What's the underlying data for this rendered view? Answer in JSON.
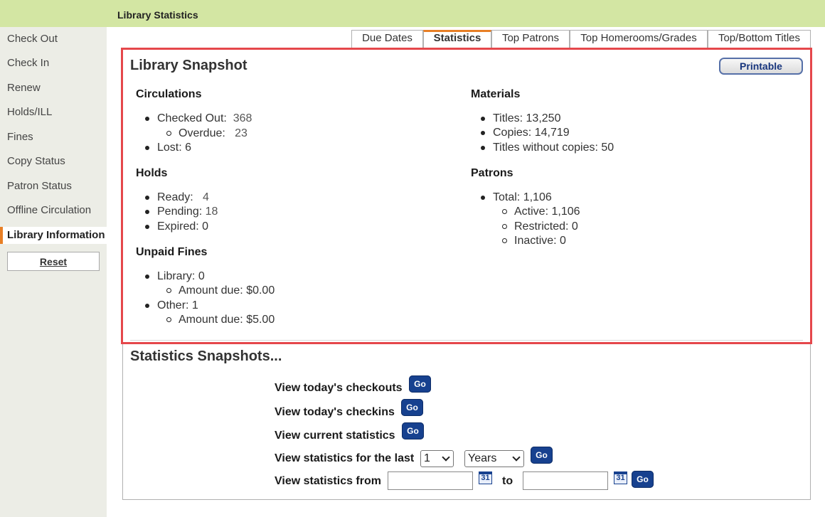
{
  "header": {
    "title": "Library Statistics"
  },
  "sidebar": {
    "items": [
      {
        "label": "Check Out"
      },
      {
        "label": "Check In"
      },
      {
        "label": "Renew"
      },
      {
        "label": "Holds/ILL"
      },
      {
        "label": "Fines"
      },
      {
        "label": "Copy Status"
      },
      {
        "label": "Patron Status"
      },
      {
        "label": "Offline Circulation"
      },
      {
        "label": "Library Information"
      }
    ],
    "reset_label": "Reset"
  },
  "tabs": [
    {
      "label": "Due Dates"
    },
    {
      "label": "Statistics",
      "active": true
    },
    {
      "label": "Top Patrons"
    },
    {
      "label": "Top Homerooms/Grades"
    },
    {
      "label": "Top/Bottom Titles"
    }
  ],
  "snapshot": {
    "title": "Library Snapshot",
    "printable_label": "Printable",
    "circulations": {
      "heading": "Circulations",
      "checked_out_label": "Checked Out:",
      "checked_out_value": "368",
      "overdue_label": "Overdue:",
      "overdue_value": "23",
      "lost_label": "Lost:",
      "lost_value": "6"
    },
    "holds": {
      "heading": "Holds",
      "ready_label": "Ready:",
      "ready_value": "4",
      "pending_label": "Pending:",
      "pending_value": "18",
      "expired_label": "Expired:",
      "expired_value": "0"
    },
    "fines": {
      "heading": "Unpaid Fines",
      "library_label": "Library:",
      "library_value": "0",
      "library_amount_label": "Amount due:",
      "library_amount_value": "$0.00",
      "other_label": "Other:",
      "other_value": "1",
      "other_amount_label": "Amount due:",
      "other_amount_value": "$5.00"
    },
    "materials": {
      "heading": "Materials",
      "titles_label": "Titles:",
      "titles_value": "13,250",
      "copies_label": "Copies:",
      "copies_value": "14,719",
      "no_copies_label": "Titles without copies:",
      "no_copies_value": "50"
    },
    "patrons": {
      "heading": "Patrons",
      "total_label": "Total:",
      "total_value": "1,106",
      "active_label": "Active:",
      "active_value": "1,106",
      "restricted_label": "Restricted:",
      "restricted_value": "0",
      "inactive_label": "Inactive:",
      "inactive_value": "0"
    }
  },
  "stats": {
    "title": "Statistics Snapshots...",
    "go_label": "Go",
    "today_checkouts": "View today's checkouts",
    "today_checkins": "View today's checkins",
    "current": "View current statistics",
    "last_label": "View statistics for the last",
    "last_count": "1",
    "last_unit": "Years",
    "from_label": "View statistics from",
    "to_label": "to",
    "cal_label": "31"
  },
  "colors": {
    "header_bg": "#d3e6a3",
    "sidebar_bg": "#ecede6",
    "accent_orange": "#e87f25",
    "highlight_red": "#e5474b",
    "go_blue": "#17418f"
  }
}
